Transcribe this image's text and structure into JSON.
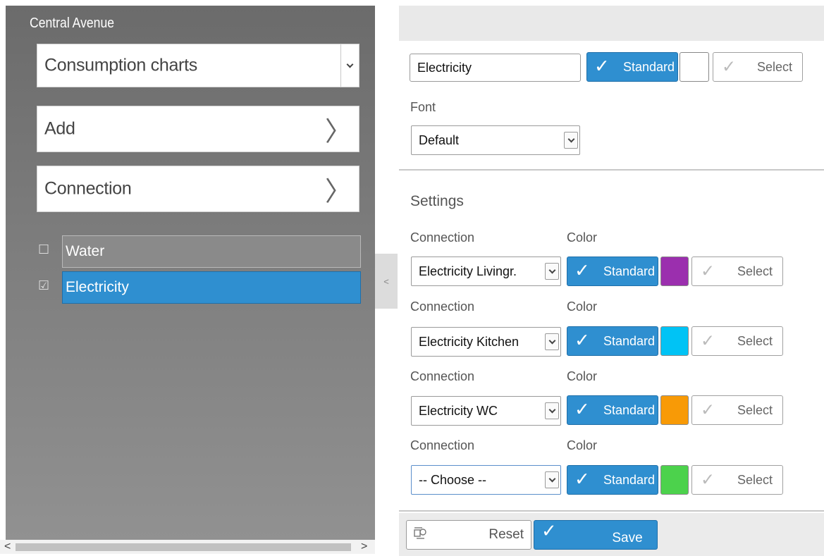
{
  "left_panel": {
    "title": "Central Avenue",
    "view_select": "Consumption charts",
    "add_label": "Add",
    "connection_label": "Connection",
    "items": [
      {
        "label": "Water",
        "checked": false,
        "checkbox": "☐"
      },
      {
        "label": "Electricity",
        "checked": true,
        "checkbox": "☑"
      }
    ],
    "collapse_glyph": "<",
    "scroll_left": "<",
    "scroll_right": ">"
  },
  "header": {
    "name_value": "Electricity",
    "standard_label": "Standard",
    "select_label": "Select",
    "check_glyph": "✓",
    "color": "#ffffff"
  },
  "font": {
    "label": "Font",
    "value": "Default"
  },
  "settings": {
    "title": "Settings",
    "connection_label": "Connection",
    "color_label": "Color",
    "rows": [
      {
        "connection": "Electricity Livingr.",
        "standard_label": "Standard",
        "select_label": "Select",
        "color": "#9b2fae"
      },
      {
        "connection": "Electricity Kitchen",
        "standard_label": "Standard",
        "select_label": "Select",
        "color": "#00c3f5"
      },
      {
        "connection": "Electricity WC",
        "standard_label": "Standard",
        "select_label": "Select",
        "color": "#f89a06"
      },
      {
        "connection": "-- Choose --",
        "standard_label": "Standard",
        "select_label": "Select",
        "color": "#4cd24c"
      }
    ]
  },
  "footer": {
    "reset_label": "Reset",
    "save_label": "Save"
  }
}
